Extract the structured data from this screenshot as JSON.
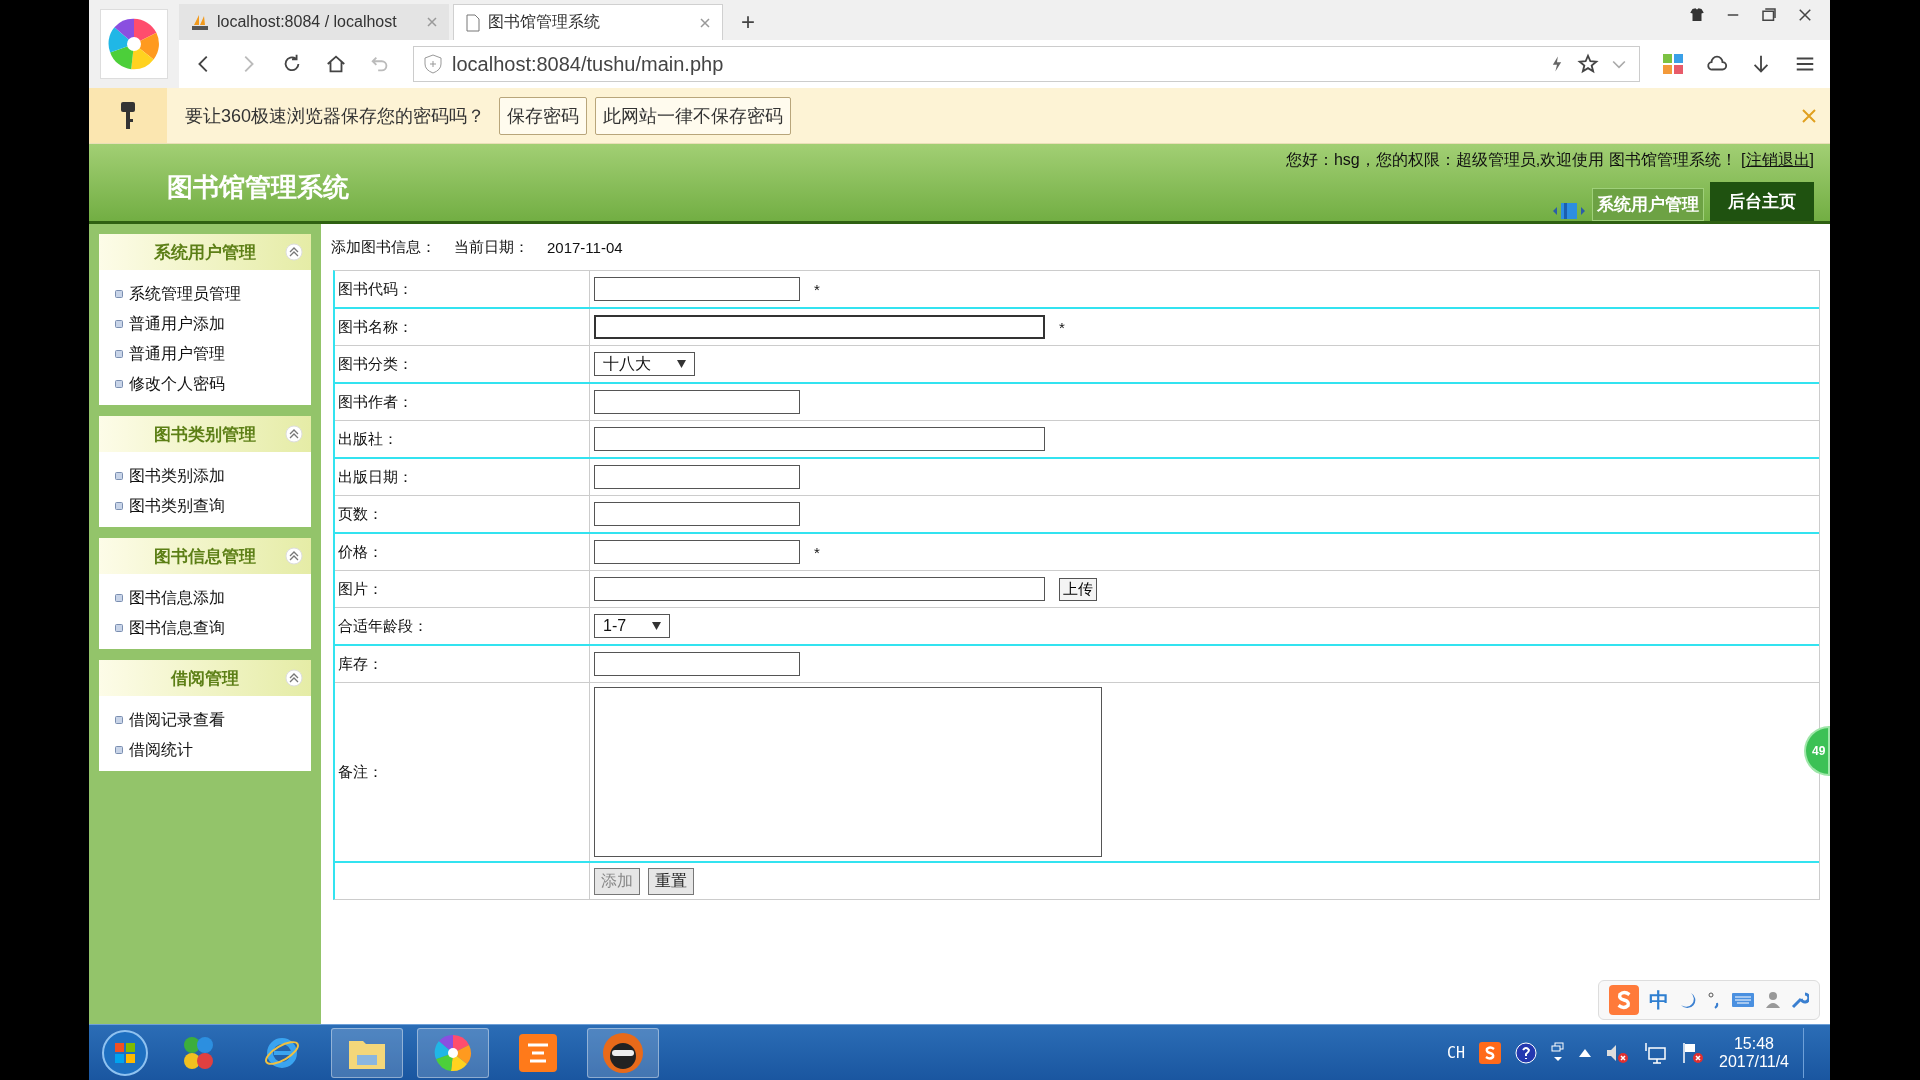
{
  "browser": {
    "tabs": [
      {
        "title": "localhost:8084 / localhost",
        "selected": false
      },
      {
        "title": "图书馆管理系统",
        "selected": true
      }
    ],
    "new_tab": "+",
    "url": "localhost:8084/tushu/main.php"
  },
  "password_bar": {
    "message": "要让360极速浏览器保存您的密码吗？",
    "buttons": [
      "保存密码",
      "此网站一律不保存密码"
    ]
  },
  "header": {
    "title": "图书馆管理系统",
    "welcome": "您好：hsg，您的权限：超级管理员,欢迎使用  图书馆管理系统！",
    "logout_open": "[",
    "logout": "注销退出",
    "logout_close": "]",
    "nav": [
      {
        "label": "系统用户管理",
        "selected": false
      },
      {
        "label": "后台主页",
        "selected": true
      }
    ]
  },
  "sidebar": {
    "groups": [
      {
        "title": "系统用户管理",
        "expanded": true,
        "items": [
          "系统管理员管理",
          "普通用户添加",
          "普通用户管理",
          "修改个人密码"
        ]
      },
      {
        "title": "图书类别管理",
        "expanded": true,
        "items": [
          "图书类别添加",
          "图书类别查询"
        ]
      },
      {
        "title": "图书信息管理",
        "expanded": true,
        "items": [
          "图书信息添加",
          "图书信息查询"
        ]
      },
      {
        "title": "借阅管理",
        "expanded": true,
        "items": [
          "借阅记录查看",
          "借阅统计"
        ]
      }
    ]
  },
  "form": {
    "heading": "添加图书信息：",
    "date_label": "当前日期：",
    "date": "2017-11-04",
    "rows": [
      {
        "label": "图书代码：",
        "kind": "short",
        "mark": "*",
        "focused": false,
        "highlight_below": true
      },
      {
        "label": "图书名称：",
        "kind": "long",
        "mark": "*",
        "focused": true,
        "highlight_below": false
      },
      {
        "label": "图书分类：",
        "kind": "select",
        "value": "十八大",
        "focused": false,
        "highlight_below": true
      },
      {
        "label": "图书作者：",
        "kind": "short",
        "focused": false,
        "highlight_below": false
      },
      {
        "label": "出版社：",
        "kind": "long",
        "focused": false,
        "highlight_below": true
      },
      {
        "label": "出版日期：",
        "kind": "short",
        "focused": false,
        "highlight_below": false
      },
      {
        "label": "页数：",
        "kind": "short",
        "focused": false,
        "highlight_below": true
      },
      {
        "label": "价格：",
        "kind": "short",
        "mark": "*",
        "focused": false,
        "highlight_below": false
      },
      {
        "label": "图片：",
        "kind": "file",
        "button": "上传",
        "focused": false,
        "highlight_below": false
      },
      {
        "label": "合适年龄段：",
        "kind": "select",
        "value": "1-7",
        "focused": false,
        "highlight_below": true
      },
      {
        "label": "库存：",
        "kind": "short",
        "focused": false,
        "highlight_below": false
      },
      {
        "label": "备注：",
        "kind": "textarea",
        "focused": false,
        "highlight_below": true
      }
    ],
    "buttons": [
      {
        "label": "添加",
        "disabled": true
      },
      {
        "label": "重置",
        "disabled": false
      }
    ]
  },
  "float_badge": "49",
  "ime_bar": {
    "mode": "中"
  },
  "taskbar": {
    "language": "CH",
    "time": "15:48",
    "date": "2017/11/4"
  }
}
